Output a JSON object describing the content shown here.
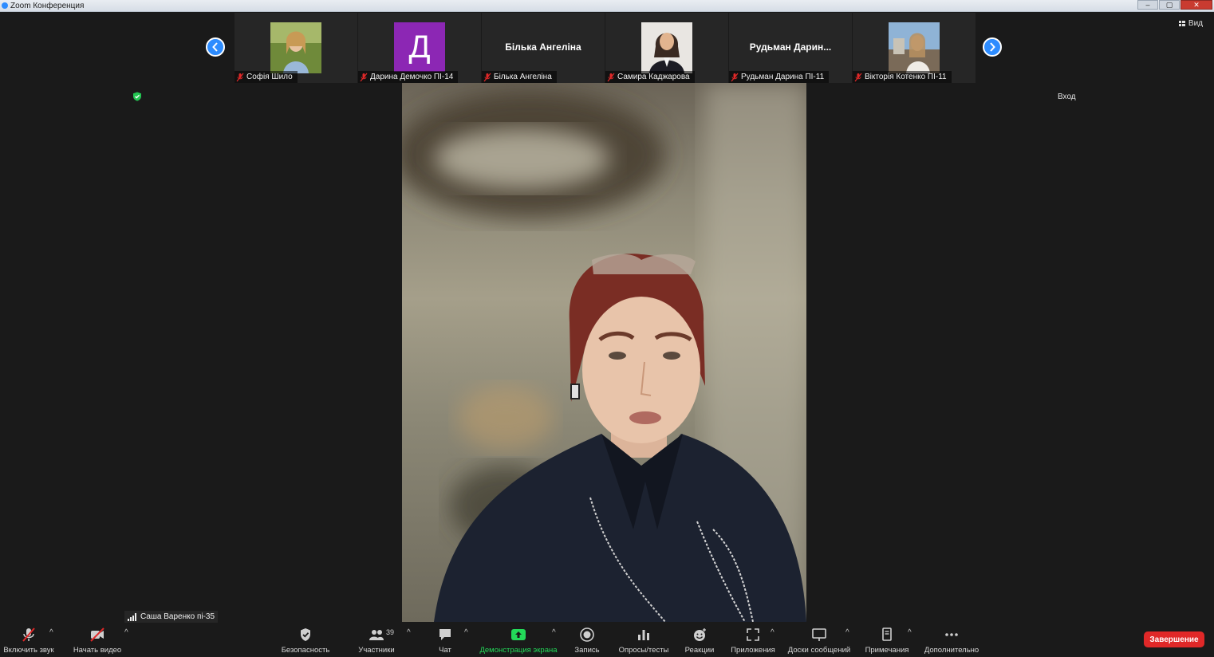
{
  "window": {
    "title": "Zoom Конференция",
    "controls": [
      "–",
      "▢",
      "✕"
    ]
  },
  "top_right": {
    "view_label": "Вид",
    "enter_label": "Вход"
  },
  "gallery": {
    "tiles": [
      {
        "name": "Софія Шило",
        "type": "photo",
        "muted": true
      },
      {
        "name": "Дарина Демочко ПІ-14",
        "type": "initial",
        "initial": "Д",
        "muted": true,
        "color": "#8c27b4"
      },
      {
        "name": "Білька Ангеліна",
        "type": "name",
        "big_name": "Білька Ангеліна",
        "muted": true
      },
      {
        "name": "Самира Каджарова",
        "type": "photo",
        "muted": true
      },
      {
        "name": "Рудьман Дарина ПІ-11",
        "type": "name",
        "big_name": "Рудьман Дарин...",
        "muted": true
      },
      {
        "name": "Вікторія Котенко ПІ-11",
        "type": "photo",
        "muted": true
      }
    ]
  },
  "self_view": {
    "name": "Саша Варенко пі-35"
  },
  "toolbar": {
    "mute_label": "Включить звук",
    "video_label": "Начать видео",
    "security_label": "Безопасность",
    "participants_label": "Участники",
    "participants_count": "39",
    "chat_label": "Чат",
    "share_label": "Демонстрация экрана",
    "record_label": "Запись",
    "polls_label": "Опросы/тесты",
    "reactions_label": "Реакции",
    "apps_label": "Приложения",
    "whiteboards_label": "Доски сообщений",
    "notes_label": "Примечания",
    "more_label": "Дополнительно",
    "end_label": "Завершение"
  },
  "colors": {
    "accent": "#2d8cff",
    "share_green": "#23d959",
    "end_red": "#e02828",
    "background": "#1a1a1a"
  }
}
